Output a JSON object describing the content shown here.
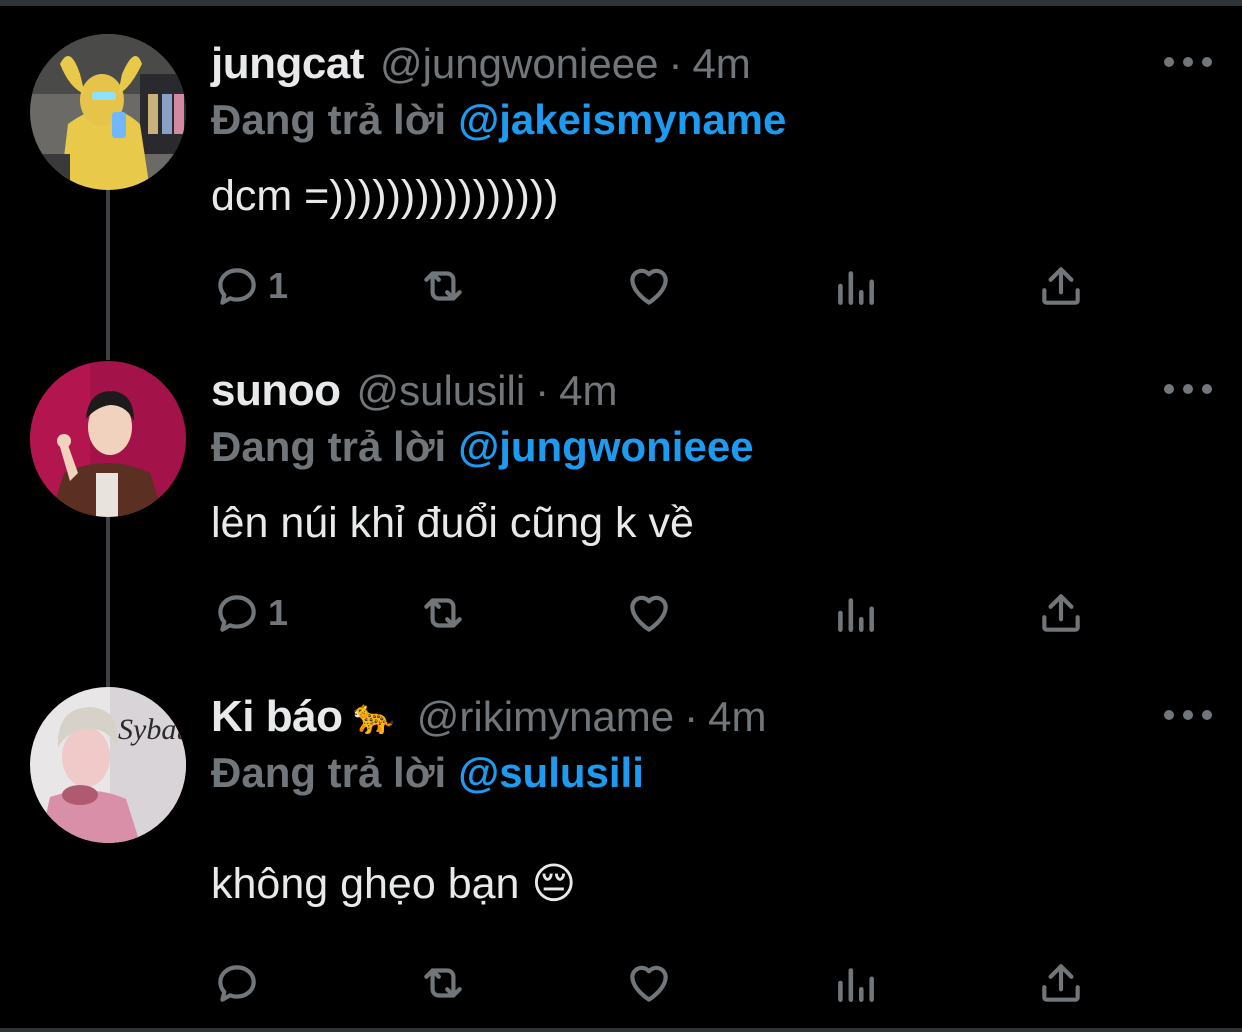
{
  "colors": {
    "background": "#000000",
    "text": "#e7e9ea",
    "secondary": "#71767b",
    "accent": "#1d9bf0"
  },
  "tweets": [
    {
      "display_name": "jungcat",
      "emoji": "",
      "handle": "@jungwonieee",
      "separator": "·",
      "time": "4m",
      "reply_prefix": "Đang trả lời",
      "reply_to": "@jakeismyname",
      "text": "dcm =))))))))))))))))",
      "reply_count": "1"
    },
    {
      "display_name": "sunoo",
      "emoji": "",
      "handle": "@sulusili",
      "separator": "·",
      "time": "4m",
      "reply_prefix": "Đang trả lời",
      "reply_to": "@jungwonieee",
      "text": "lên núi khỉ đuổi cũng k về",
      "reply_count": "1"
    },
    {
      "display_name": "Ki báo",
      "emoji": "🐆",
      "handle": "@rikimyname",
      "separator": "·",
      "time": "4m",
      "reply_prefix": "Đang trả lời",
      "reply_to": "@sulusili",
      "text": "không ghẹo bạn 😔",
      "reply_count": "",
      "avatar_overlay_text": "Sybau"
    }
  ],
  "icons": {
    "reply": "reply-icon",
    "retweet": "retweet-icon",
    "like": "heart-icon",
    "views": "analytics-icon",
    "share": "share-icon",
    "more": "more-icon"
  }
}
